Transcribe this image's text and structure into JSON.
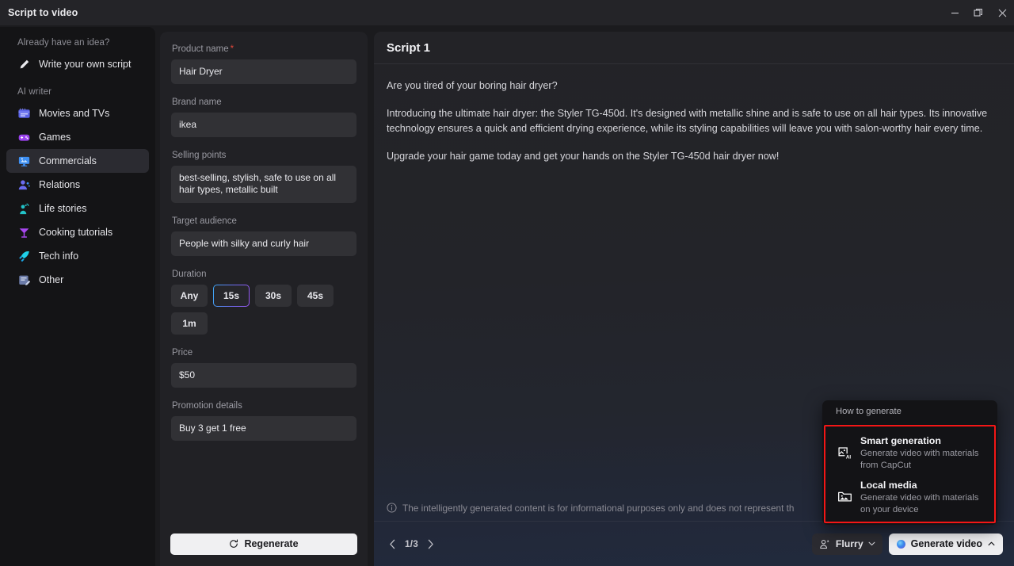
{
  "window": {
    "title": "Script to video",
    "controls": [
      {
        "name": "minimize",
        "glyph": "minimize-icon"
      },
      {
        "name": "maximize",
        "glyph": "restore-icon"
      },
      {
        "name": "close",
        "glyph": "close-icon"
      }
    ]
  },
  "sidebar": {
    "group1_label": "Already have an idea?",
    "group1_items": [
      {
        "label": "Write your own script",
        "icon": "pencil-icon"
      }
    ],
    "group2_label": "AI writer",
    "group2_items": [
      {
        "label": "Movies and TVs",
        "icon": "clapperboard-icon",
        "active": false
      },
      {
        "label": "Games",
        "icon": "gamepad-icon",
        "active": false
      },
      {
        "label": "Commercials",
        "icon": "monitor-icon",
        "active": true
      },
      {
        "label": "Relations",
        "icon": "person-add-icon",
        "active": false
      },
      {
        "label": "Life stories",
        "icon": "person-wave-icon",
        "active": false
      },
      {
        "label": "Cooking tutorials",
        "icon": "cocktail-glass-icon",
        "active": false
      },
      {
        "label": "Tech info",
        "icon": "rocket-icon",
        "active": false
      },
      {
        "label": "Other",
        "icon": "document-edit-icon",
        "active": false
      }
    ]
  },
  "form": {
    "product_name_label": "Product name",
    "product_name_required": "*",
    "product_name_value": "Hair Dryer",
    "brand_name_label": "Brand name",
    "brand_name_value": "ikea",
    "selling_points_label": "Selling points",
    "selling_points_value": "best-selling, stylish, safe to use on all hair types, metallic built",
    "target_audience_label": "Target audience",
    "target_audience_value": "People with silky and curly hair",
    "duration_label": "Duration",
    "duration_options": [
      "Any",
      "15s",
      "30s",
      "45s",
      "1m"
    ],
    "duration_selected": "15s",
    "price_label": "Price",
    "price_value": "$50",
    "promotion_label": "Promotion details",
    "promotion_value": "Buy 3 get 1 free",
    "regenerate_label": "Regenerate",
    "regenerate_icon": "refresh-icon"
  },
  "script": {
    "title": "Script 1",
    "paragraphs": [
      "Are you tired of your boring hair dryer?",
      "Introducing the ultimate hair dryer: the Styler TG-450d. It's designed with metallic shine and is safe to use on all hair types. Its innovative technology ensures a quick and efficient drying experience, while its styling capabilities will leave you with salon-worthy hair every time.",
      "Upgrade your hair game today and get your hands on the Styler TG-450d hair dryer now!"
    ],
    "disclaimer": "The intelligently generated content is for informational purposes only and does not represent th",
    "disclaimer_icon": "info-icon",
    "pager_prev_icon": "chevron-left-icon",
    "pager_next_icon": "chevron-right-icon",
    "pager_count": "1/3",
    "flurry_label": "Flurry",
    "flurry_icon": "voice-icon",
    "flurry_caret": "chevron-down-icon",
    "generate_label": "Generate video",
    "generate_caret": "chevron-up-icon"
  },
  "popup": {
    "header": "How to generate",
    "highlight_color": "#f31616",
    "items": [
      {
        "title": "Smart generation",
        "subtitle": "Generate video with materials from CapCut",
        "icon": "image-ai-icon"
      },
      {
        "title": "Local media",
        "subtitle": "Generate video with materials on your device",
        "icon": "folder-image-icon"
      }
    ]
  }
}
